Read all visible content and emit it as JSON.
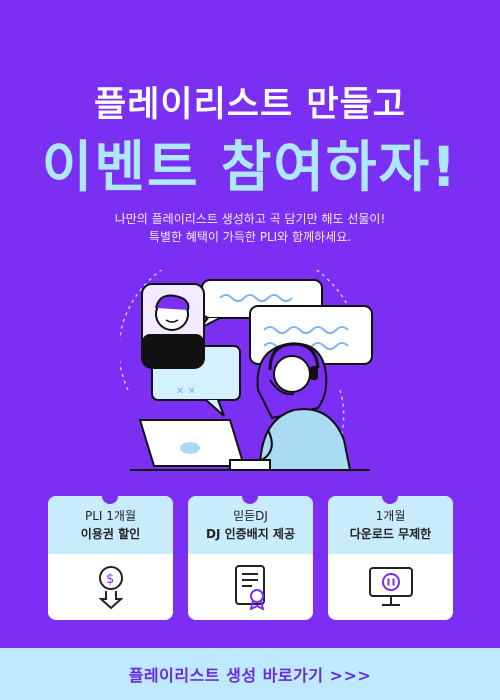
{
  "header": {
    "title_line1": "플레이리스트 만들고",
    "title_line2": "이벤트 참여하자!"
  },
  "description": {
    "line1": "나만의 플레이리스트 생성하고 곡 담기만 해도 선물이!",
    "line2": "특별한 혜택이 가득한 PLI와 함께하세요."
  },
  "benefits": [
    {
      "line1": "PLI 1개월",
      "line2": "이용권 할인",
      "icon": "dollar-download-icon"
    },
    {
      "line1": "믿듣DJ",
      "line2": "DJ 인증배지 제공",
      "icon": "certificate-badge-icon"
    },
    {
      "line1": "1개월",
      "line2": "다운로드 무제한",
      "icon": "monitor-pause-icon"
    }
  ],
  "cta": {
    "label": "플레이리스트 생성 바로가기 >>>"
  },
  "colors": {
    "background": "#7b2ff2",
    "accent": "#aee8ff",
    "card_head": "#c8ecfb",
    "cta_bg": "#bfe9ff",
    "cta_text": "#6a2bd9"
  }
}
